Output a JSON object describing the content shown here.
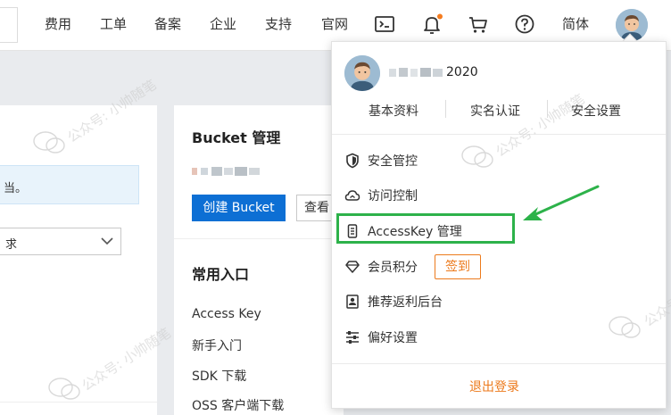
{
  "topnav": {
    "items": [
      {
        "label": "费用"
      },
      {
        "label": "工单"
      },
      {
        "label": "备案"
      },
      {
        "label": "企业"
      },
      {
        "label": "支持"
      },
      {
        "label": "官网"
      }
    ],
    "icons": [
      "terminal-icon",
      "bell-icon",
      "cart-icon",
      "help-icon"
    ],
    "language": "简体",
    "notification_dot_color": "#f57c1f"
  },
  "left_panel": {
    "info_text": "当。",
    "select_value": "求"
  },
  "bucket_card": {
    "title": "Bucket 管理",
    "create_button": "创建 Bucket",
    "view_button": "查看"
  },
  "common_entry": {
    "title": "常用入口",
    "links": [
      "Access Key",
      "新手入门",
      "SDK 下载",
      "OSS 客户端下载"
    ]
  },
  "profile_menu": {
    "username_suffix": "2020",
    "tabs": [
      "基本资料",
      "实名认证",
      "安全设置"
    ],
    "items": [
      {
        "label": "安全管控",
        "icon": "shield-icon"
      },
      {
        "label": "访问控制",
        "icon": "cloud-icon"
      },
      {
        "label": "AccessKey 管理",
        "icon": "key-icon"
      },
      {
        "label": "会员积分",
        "icon": "diamond-icon"
      },
      {
        "label": "推荐返利后台",
        "icon": "id-card-icon"
      },
      {
        "label": "偏好设置",
        "icon": "sliders-icon"
      }
    ],
    "sign_in_button": "签到",
    "logout": "退出登录"
  },
  "watermark_text": "公众号: 小帅随笔",
  "colors": {
    "primary": "#0d6fd4",
    "accent_orange": "#ec7a1c",
    "highlight_green": "#2db24a"
  }
}
